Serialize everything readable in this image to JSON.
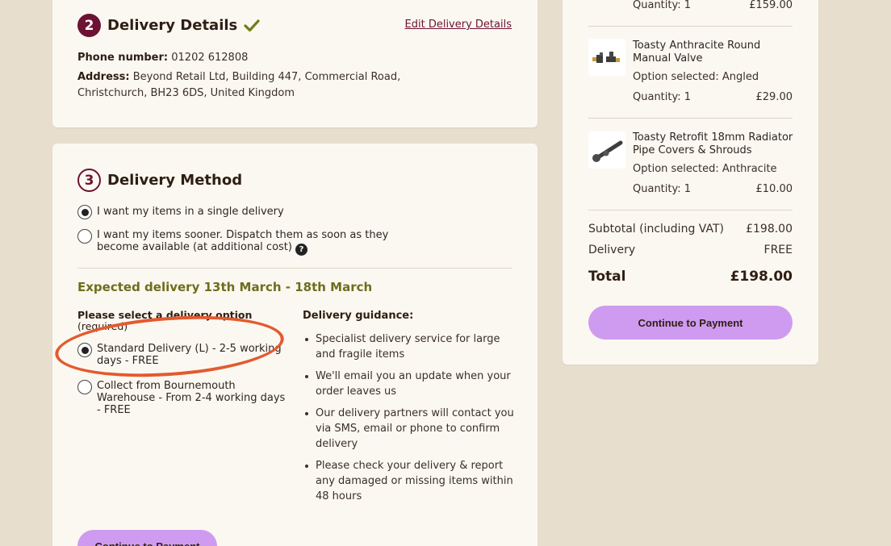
{
  "delivery_details": {
    "step": "2",
    "title": "Delivery Details",
    "edit_link": "Edit Delivery Details",
    "phone_label": "Phone number:",
    "phone_value": "01202 612808",
    "address_label": "Address:",
    "address_line1": "Beyond Retail Ltd, Building 447, Commercial Road,",
    "address_line2": "Christchurch, BH23 6DS, United Kingdom"
  },
  "delivery_method": {
    "step": "3",
    "title": "Delivery Method",
    "single_delivery": "I want my items in a single delivery",
    "sooner_line1": "I want my items sooner. Dispatch them as soon as they",
    "sooner_line2": "become available (at additional cost)",
    "help_glyph": "?",
    "expected": "Expected delivery 13th March - 18th March",
    "option_label": "Please select a delivery option",
    "required": "(required)",
    "options": [
      {
        "line1": "Standard Delivery (L) - 2-5 working",
        "line2": "days - FREE",
        "selected": true
      },
      {
        "line1": "Collect from Bournemouth",
        "line2": "Warehouse - From 2-4 working days",
        "line3": "- FREE",
        "selected": false
      }
    ],
    "guidance_title": "Delivery guidance:",
    "guidance": [
      "Specialist delivery service for large and fragile items",
      "We'll email you an update when your order leaves us",
      "Our delivery partners will contact you via SMS, email or phone to confirm delivery",
      "Please check your delivery & report any damaged or missing items within 48 hours"
    ],
    "continue_label": "Continue to Payment"
  },
  "summary": {
    "top_qty": "Quantity: 1",
    "top_price": "£159.00",
    "items": [
      {
        "name": "Toasty Anthracite Round Manual Valve",
        "option": "Option selected: Angled",
        "qty": "Quantity: 1",
        "price": "£29.00"
      },
      {
        "name": "Toasty Retrofit 18mm Radiator Pipe Covers & Shrouds",
        "option": "Option selected: Anthracite",
        "qty": "Quantity: 1",
        "price": "£10.00"
      }
    ],
    "subtotal_label": "Subtotal (including VAT)",
    "subtotal_value": "£198.00",
    "delivery_label": "Delivery",
    "delivery_value": "FREE",
    "total_label": "Total",
    "total_value": "£198.00",
    "continue_label": "Continue to Payment"
  },
  "colors": {
    "background": "#e7dece",
    "card": "#fbf8f1",
    "step_accent": "#6d1233",
    "check_green": "#6f7d1a",
    "expected_text": "#6f6d1d",
    "button": "#cf9bf0",
    "annotation": "#e35a2f"
  }
}
